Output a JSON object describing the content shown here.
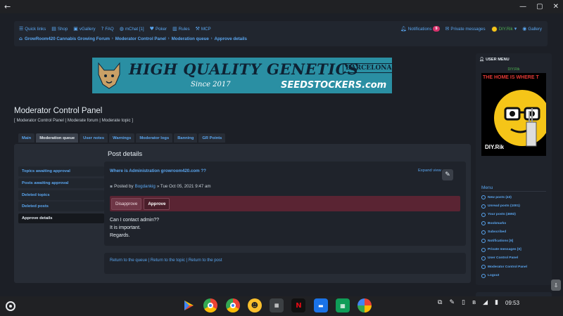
{
  "nav": {
    "quick_links": "Quick links",
    "shop": "Shop",
    "vgallery": "vGallery",
    "faq": "FAQ",
    "mchat": "mChat [1]",
    "poker": "Poker",
    "rules": "Rules",
    "mcp": "MCP",
    "notifications": "Notifications",
    "notifications_count": "9",
    "private_messages": "Private messages",
    "username": "DIY.Rik",
    "gallery": "Gallery"
  },
  "breadcrumbs": [
    "GrowRoom420 Cannabis Growing Forum",
    "Moderator Control Panel",
    "Moderation queue",
    "Approve details"
  ],
  "banner": {
    "headline": "HIGH QUALITY GENETICS",
    "since": "Since 2017",
    "city": "BARCELONA",
    "brand": "SEEDSTOCKERS.com"
  },
  "page": {
    "title": "Moderator Control Panel",
    "sub_links": "[ Moderator Control Panel | Moderate forum | Moderate topic ]"
  },
  "tabs": [
    "Main",
    "Moderation queue",
    "User notes",
    "Warnings",
    "Moderator logs",
    "Banning",
    "GR Points"
  ],
  "active_tab": "Moderation queue",
  "side_menu": [
    "Topics awaiting approval",
    "Posts awaiting approval",
    "Deleted topics",
    "Deleted posts",
    "Approve details"
  ],
  "post": {
    "heading": "Post details",
    "topic": "Where is Administration growroom420.com ??",
    "expand_view": "Expand view",
    "posted_by_label": "Posted by",
    "author": "Bogdankig",
    "date": "» Tue Oct 05, 2021 9:47 am",
    "disapprove": "Disapprove",
    "approve": "Approve",
    "body": [
      "Can I contact admin??",
      "It is important.",
      "Regards."
    ]
  },
  "footer_links": "Return to the queue | Return to the topic | Return to the post",
  "user_menu": {
    "title": "USER MENU",
    "username": "DIY.Rik",
    "avatar_motto": "THE HOME IS WHERE T",
    "avatar_name": "DIY.Rik",
    "menu_title": "Menu",
    "items": [
      "New posts (43)",
      "Unread posts (1001)",
      "Your posts (4692)",
      "Bookmarks",
      "Subscribed",
      "Notifications [9]",
      "Private messages [0]",
      "User Control Panel",
      "Moderator Control Panel",
      "Logout"
    ]
  },
  "shelf": {
    "time": "09:53",
    "apps": [
      "play-store",
      "chrome",
      "chrome-beta",
      "app-yellow",
      "video-app",
      "netflix",
      "files",
      "sheets",
      "photos"
    ]
  },
  "colors": {
    "background": "#1c1f26",
    "panel": "#272c35",
    "link": "#5aa6f0",
    "approve_bar": "#5a2433",
    "online_user": "#4caf50"
  }
}
